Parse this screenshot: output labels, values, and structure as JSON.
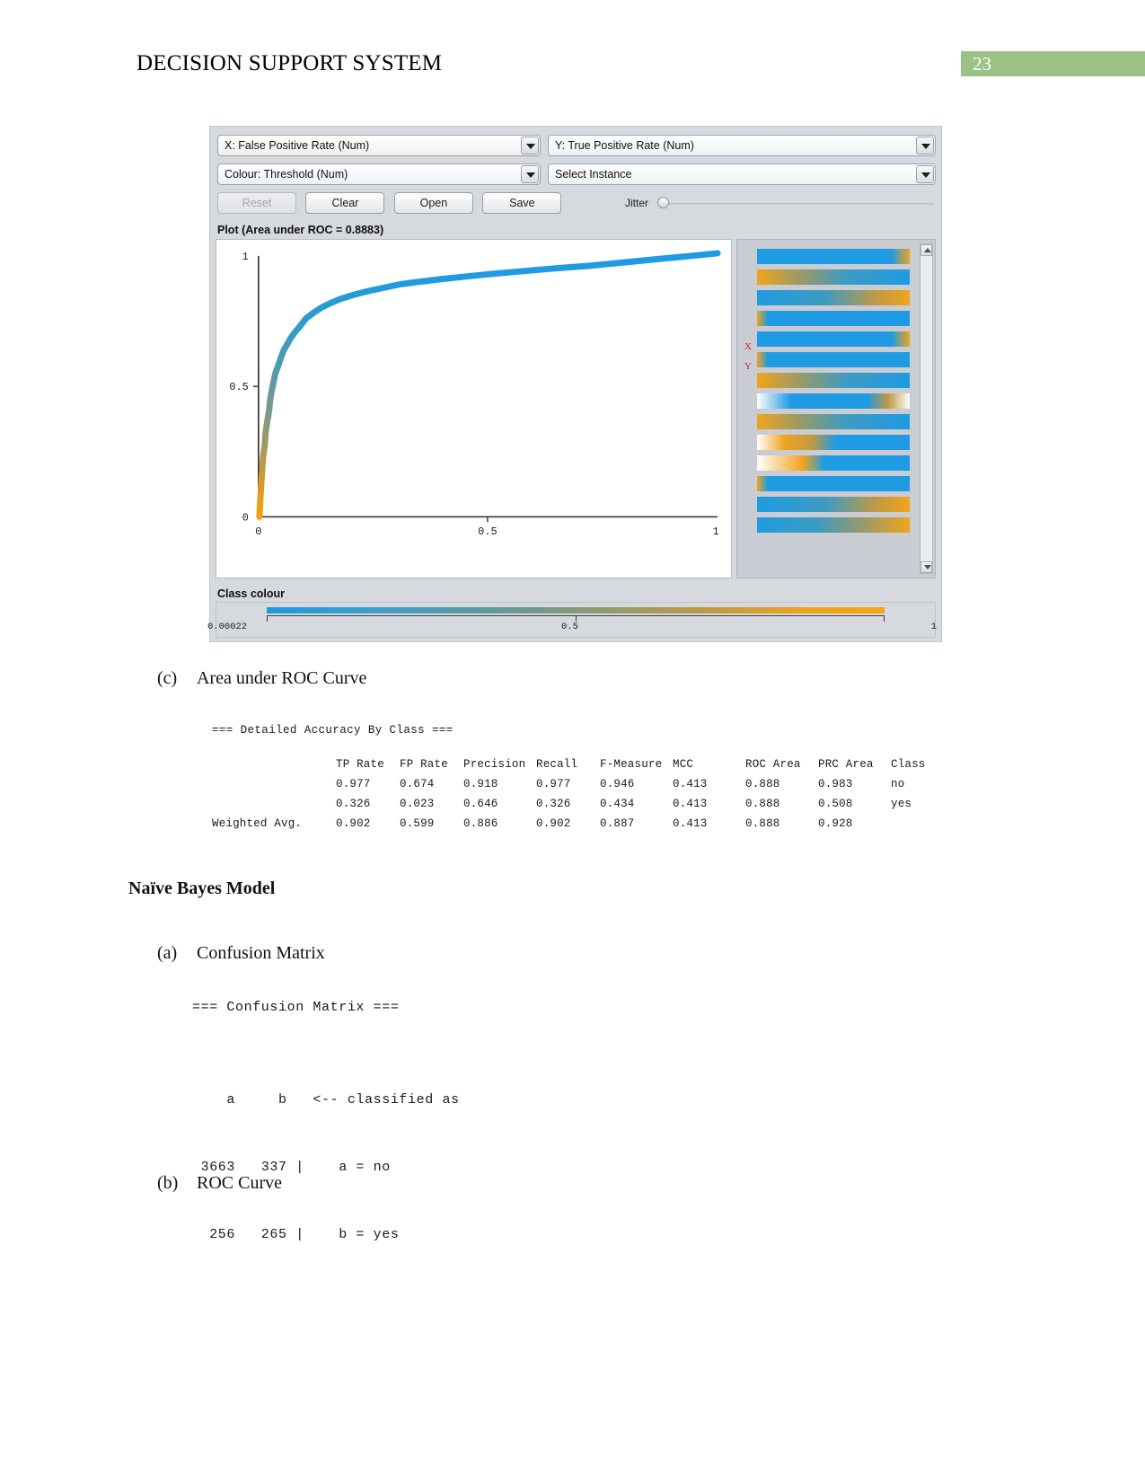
{
  "page_header": {
    "title": "DECISION SUPPORT SYSTEM",
    "page_number": "23"
  },
  "weka_plot": {
    "x_attribute": "X: False Positive Rate (Num)",
    "y_attribute": "Y: True Positive Rate (Num)",
    "colour_attribute": "Colour: Threshold (Num)",
    "select_instance": "Select Instance",
    "buttons": {
      "reset": "Reset",
      "clear": "Clear",
      "open": "Open",
      "save": "Save"
    },
    "jitter_label": "Jitter",
    "plot_caption": "Plot (Area under ROC = 0.8883)",
    "side_panel": {
      "x_marker": "X",
      "y_marker": "Y"
    },
    "class_colour_label": "Class colour",
    "class_colour_scale": {
      "min": "0.00022",
      "mid": "0.5",
      "max": "1"
    }
  },
  "chart_data": {
    "type": "line",
    "title": "Plot (Area under ROC = 0.8883)",
    "xlabel": "False Positive Rate",
    "ylabel": "True Positive Rate",
    "xlim": [
      0,
      1
    ],
    "ylim": [
      0,
      1
    ],
    "xticks": [
      "0",
      "0.5",
      "1"
    ],
    "yticks": [
      "0",
      "0.5",
      "1"
    ],
    "grid": false,
    "legend": "none",
    "area_under_roc": 0.8883,
    "colour_encoding": "Threshold (Num) mapped blue(1) -> teal -> orange(0.00022)",
    "series": [
      {
        "name": "ROC Curve",
        "x": [
          0.0,
          0.002,
          0.004,
          0.006,
          0.008,
          0.01,
          0.013,
          0.016,
          0.019,
          0.022,
          0.026,
          0.03,
          0.035,
          0.04,
          0.046,
          0.052,
          0.06,
          0.068,
          0.078,
          0.09,
          0.102,
          0.118,
          0.135,
          0.155,
          0.178,
          0.205,
          0.235,
          0.27,
          0.31,
          0.355,
          0.405,
          0.46,
          0.52,
          0.585,
          0.655,
          0.73,
          0.81,
          0.89,
          0.95,
          1.0
        ],
        "y": [
          0.0,
          0.06,
          0.12,
          0.175,
          0.225,
          0.275,
          0.325,
          0.37,
          0.41,
          0.448,
          0.485,
          0.52,
          0.553,
          0.583,
          0.612,
          0.64,
          0.668,
          0.694,
          0.718,
          0.742,
          0.762,
          0.783,
          0.802,
          0.818,
          0.833,
          0.846,
          0.858,
          0.869,
          0.88,
          0.89,
          0.9,
          0.91,
          0.92,
          0.93,
          0.941,
          0.952,
          0.964,
          0.977,
          0.988,
          1.0
        ]
      }
    ]
  },
  "captions": {
    "c_label": "(c)",
    "c_text": "Area under ROC Curve",
    "section_title": "Naïve Bayes Model",
    "a_label": "(a)",
    "a_text": "Confusion Matrix",
    "b_label": "(b)",
    "b_text": "ROC Curve"
  },
  "detailed_accuracy": {
    "heading": "=== Detailed Accuracy By Class ===",
    "columns": [
      "",
      "TP Rate",
      "FP Rate",
      "Precision",
      "Recall",
      "F-Measure",
      "MCC",
      "ROC Area",
      "PRC Area",
      "Class"
    ],
    "rows": [
      [
        "",
        "0.977",
        "0.674",
        "0.918",
        "0.977",
        "0.946",
        "0.413",
        "0.888",
        "0.983",
        "no"
      ],
      [
        "",
        "0.326",
        "0.023",
        "0.646",
        "0.326",
        "0.434",
        "0.413",
        "0.888",
        "0.508",
        "yes"
      ],
      [
        "Weighted Avg.",
        "0.902",
        "0.599",
        "0.886",
        "0.902",
        "0.887",
        "0.413",
        "0.888",
        "0.928",
        ""
      ]
    ]
  },
  "confusion_matrix": {
    "heading": "=== Confusion Matrix ===",
    "header_line": "    a     b   <-- classified as",
    "rows": [
      " 3663   337 |    a = no",
      "  256   265 |    b = yes"
    ]
  }
}
